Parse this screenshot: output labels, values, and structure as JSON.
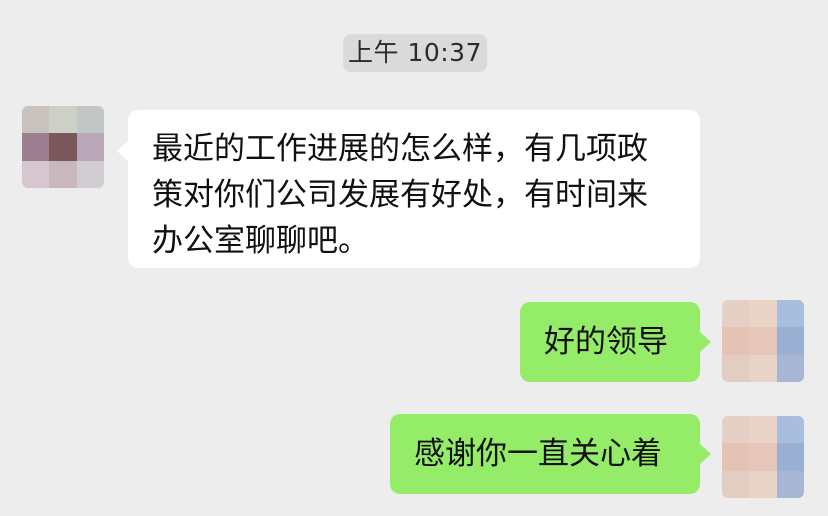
{
  "timestamp": "上午 10:37",
  "messages": [
    {
      "direction": "incoming",
      "lines": [
        "最近的工作进展的怎么样，有几项政",
        "策对你们公司发展有好处，有时间来",
        "办公室聊聊吧。"
      ]
    },
    {
      "direction": "outgoing",
      "text": "好的领导"
    },
    {
      "direction": "outgoing",
      "text": "感谢你一直关心着"
    }
  ],
  "colors": {
    "background": "#ededed",
    "incoming_bubble": "#ffffff",
    "outgoing_bubble": "#95ec69",
    "timestamp_bg": "#dadada"
  },
  "avatars": {
    "contact": [
      "#c9c2bf",
      "#cdd0c4",
      "#c2c6c4",
      "#9b7f8e",
      "#7b565b",
      "#b9a7b8",
      "#d6c6d0",
      "#c8b8be",
      "#d2cdd2"
    ],
    "self": [
      "#e6cfc4",
      "#ead4c8",
      "#a9bede",
      "#e5c3b4",
      "#e6c6b8",
      "#9aafd2",
      "#e3ccc2",
      "#e8d3c7",
      "#a7b6d4"
    ]
  }
}
